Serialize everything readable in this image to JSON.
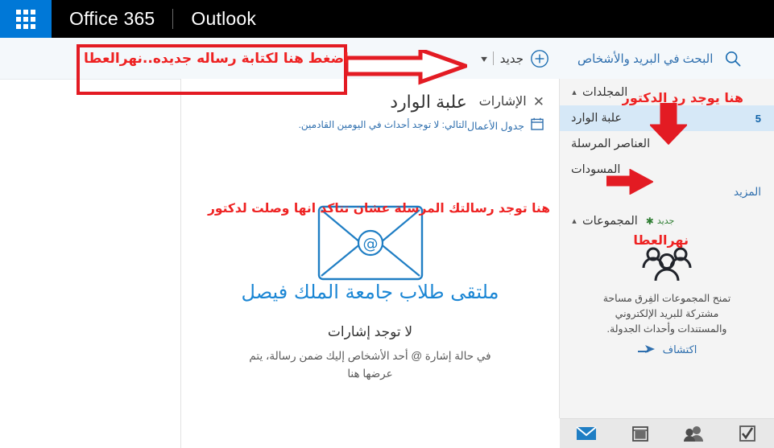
{
  "suite": {
    "app_name": "Outlook",
    "suite_name": "Office 365",
    "waffle_icon": "app-launcher-grid-icon"
  },
  "command_bar": {
    "new_label": "جديد",
    "new_plus_icon": "plus-circle-icon",
    "new_chevron_icon": "chevron-down-icon",
    "search_placeholder": "البحث في البريد والأشخاص",
    "search_icon": "search-icon"
  },
  "nav": {
    "folders_section": {
      "title": "المجلدات",
      "caret_icon": "chevron-up-icon",
      "items": [
        {
          "label": "علبة الوارد",
          "count": "5",
          "selected": true
        },
        {
          "label": "العناصر المرسلة",
          "count": "",
          "selected": false
        },
        {
          "label": "المسودات",
          "count": "",
          "selected": false
        }
      ],
      "more_label": "المزيد"
    },
    "groups_section": {
      "title": "المجموعات",
      "caret_icon": "chevron-up-icon",
      "new_label": "جديد",
      "new_star_icon": "sparkle-icon",
      "illustration_icon": "group-people-icon",
      "description": "تمنح المجموعات الفِرق مساحة مشتركة للبريد الإلكتروني والمستندات وأحداث الجدولة.",
      "cta_label": "اكتشاف",
      "cta_icon": "discover-arrow-icon"
    },
    "bottom_bar": [
      {
        "icon": "tasks-checkbox-icon",
        "name": "tasks",
        "active": false
      },
      {
        "icon": "people-icon",
        "name": "people",
        "active": false
      },
      {
        "icon": "calendar-icon",
        "name": "calendar",
        "active": false
      },
      {
        "icon": "mail-envelope-icon",
        "name": "mail",
        "active": true
      }
    ]
  },
  "main": {
    "title": "علبة الوارد",
    "subtitle": "التالي: لا توجد أحداث في اليومين القادمين.",
    "mentions_label": "الإشارات",
    "mentions_close_icon": "close-x-icon",
    "agenda_label": "جدول الأعمال",
    "agenda_icon": "calendar-icon",
    "envelope_icon": "envelope-at-icon",
    "watermark": "ملتقى طلاب جامعة الملك فيصل",
    "empty_title": "لا توجد إشارات",
    "empty_desc": "في حالة إشارة @ أحد الأشخاص إليك ضمن رسالة، يتم عرضها هنا"
  },
  "annotations": {
    "color": "#ee2222",
    "compose_box_text": "اضغط هنا لكتابة رساله جديده..نهرالعطا",
    "reply_text": "هنا يوجد رد الدكتور",
    "sent_desc_text": "هنا توجد رسالتك المرسلة عشان تتاكد انها وصلت لدكتور",
    "signature_text": "نهرالعطا",
    "arrow_compose": "right-arrow-annotation",
    "arrow_inbox": "down-arrow-annotation",
    "arrow_sent": "right-arrow-annotation"
  }
}
